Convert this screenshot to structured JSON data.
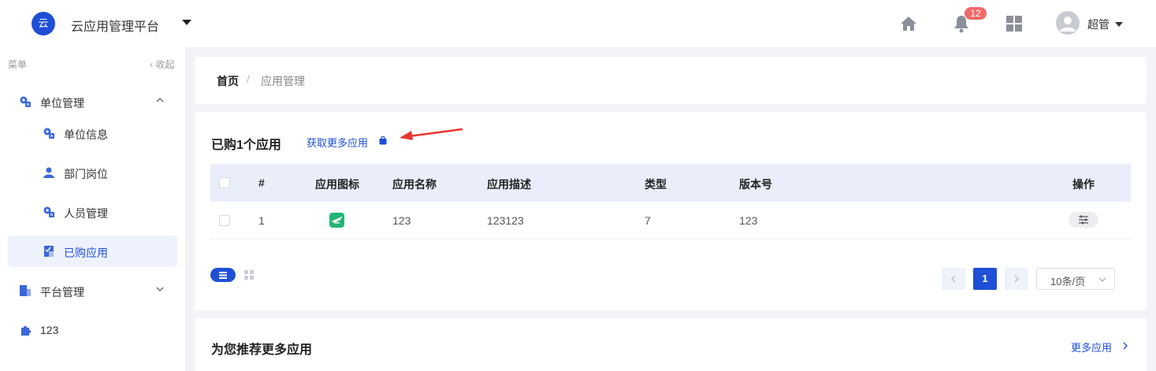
{
  "header": {
    "logo_text": "云",
    "app_title": "云应用管理平台",
    "notification_count": "12",
    "username": "超管",
    "icons": [
      "home-icon",
      "bell-icon",
      "apps-grid-icon",
      "user-avatar"
    ]
  },
  "sidebar": {
    "caption": "菜单",
    "collapse_label": "‹ 收起",
    "items": [
      {
        "label": "单位管理",
        "icon": "org-gear-icon",
        "expanded": true
      },
      {
        "label": "单位信息",
        "icon": "org-gear-icon"
      },
      {
        "label": "部门岗位",
        "icon": "person-icon"
      },
      {
        "label": "人员管理",
        "icon": "people-gear-icon"
      },
      {
        "label": "已购应用",
        "icon": "purchased-app-icon",
        "active": true
      },
      {
        "label": "平台管理",
        "icon": "building-icon",
        "expanded": false
      },
      {
        "label": "123",
        "icon": "puzzle-icon"
      }
    ]
  },
  "breadcrumb": {
    "home": "首页",
    "separator": "/",
    "current": "应用管理"
  },
  "purchased": {
    "title": "已购1个应用",
    "more_link": "获取更多应用",
    "table": {
      "headers": [
        "#",
        "应用图标",
        "应用名称",
        "应用描述",
        "类型",
        "版本号",
        "操作"
      ],
      "rows": [
        {
          "index": "1",
          "name": "123",
          "description": "123123",
          "type": "7",
          "version": "123"
        }
      ]
    },
    "pagination": {
      "current_page": "1",
      "page_size": "10条/页"
    }
  },
  "recommend": {
    "title": "为您推荐更多应用",
    "more_link": "更多应用"
  },
  "colors": {
    "accent": "#1f4fd6",
    "badge": "#f06a6a",
    "app_icon": "#22b573",
    "arrow": "#e8362f"
  }
}
